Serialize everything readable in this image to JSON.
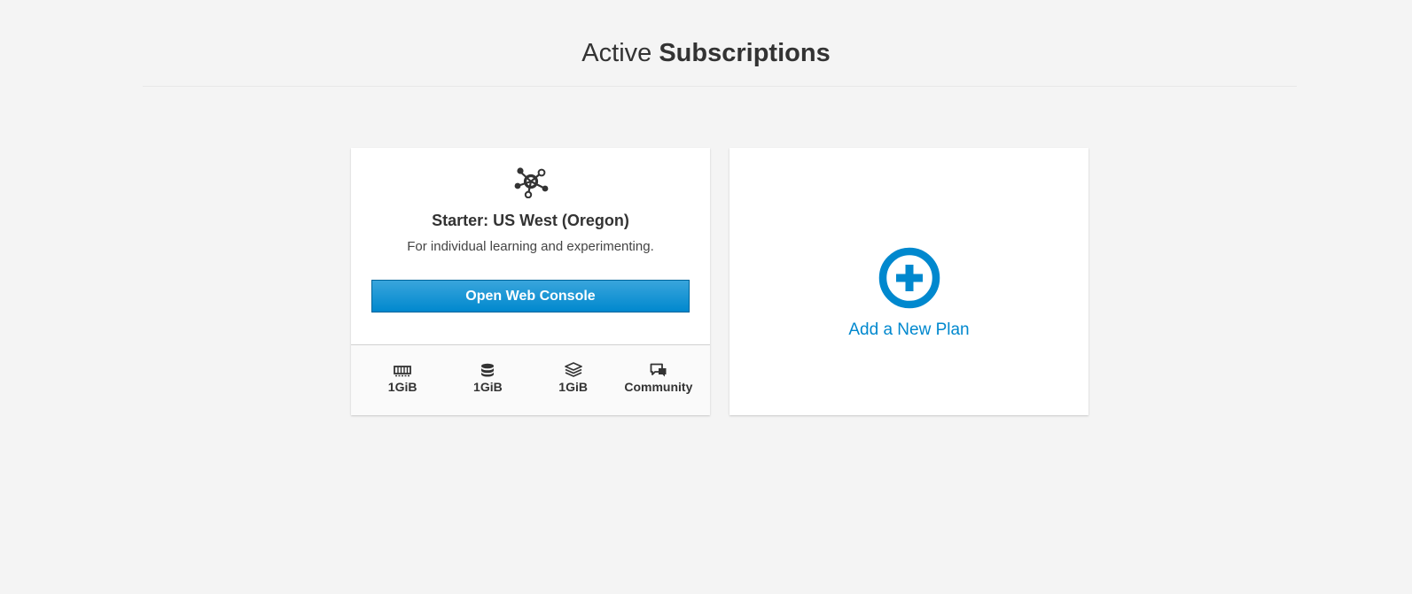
{
  "header": {
    "title_light": "Active",
    "title_bold": "Subscriptions"
  },
  "plan_card": {
    "icon": "network-nodes-icon",
    "title": "Starter: US West (Oregon)",
    "description": "For individual learning and experimenting.",
    "button_label": "Open Web Console",
    "stats": [
      {
        "icon": "memory-icon",
        "label": "1GiB"
      },
      {
        "icon": "database-icon",
        "label": "1GiB"
      },
      {
        "icon": "layers-icon",
        "label": "1GiB"
      },
      {
        "icon": "chat-icon",
        "label": "Community"
      }
    ]
  },
  "add_card": {
    "icon": "plus-circle-icon",
    "label": "Add a New Plan"
  },
  "colors": {
    "background": "#f4f4f4",
    "accent": "#0088ce",
    "button_top": "#39a5dc",
    "button_border": "#00659c",
    "text": "#333333"
  }
}
